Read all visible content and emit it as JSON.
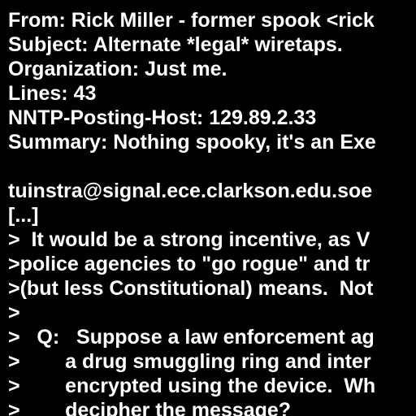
{
  "colors": {
    "background": "#000000",
    "text": "#ffffff"
  },
  "lines": [
    "From: Rick Miller - former spook <rick",
    "Subject: Alternate *legal* wiretaps.",
    "Organization: Just me.",
    "Lines: 43",
    "NNTP-Posting-Host: 129.89.2.33",
    "Summary: Nothing spooky, it's an Exe",
    "",
    "tuinstra@signal.ece.clarkson.edu.soe",
    "[...]",
    ">  It would be a strong incentive, as V",
    ">police agencies to \"go rogue\" and tr",
    ">(but less Constitutional) means.  Not",
    ">",
    ">   Q:   Suppose a law enforcement ag",
    ">        a drug smuggling ring and inter",
    ">        encrypted using the device.  Wh",
    ">        decipher the message?"
  ]
}
